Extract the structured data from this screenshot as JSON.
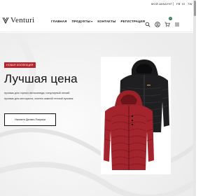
{
  "utility_bar": {
    "account_label": "МОЙ АККАУНТ",
    "social": [
      {
        "name": "facebook-icon",
        "label": "FB"
      },
      {
        "name": "instagram-icon",
        "label": "IG"
      },
      {
        "name": "twitter-icon",
        "label": "TW"
      }
    ]
  },
  "header": {
    "logo_text": "Venturi",
    "nav": [
      {
        "label": "ГЛАВНАЯ",
        "has_dropdown": false
      },
      {
        "label": "ПРОДУКТЫ",
        "has_dropdown": true
      },
      {
        "label": "КОНТАКТЫ",
        "has_dropdown": false
      },
      {
        "label": "РЕГИСТРАЦИЯ",
        "has_dropdown": false
      }
    ],
    "icons": [
      "search-icon",
      "user-icon",
      "cart-icon",
      "menu-icon"
    ],
    "cart_count": "0"
  },
  "hero": {
    "tag": "НОВАЯ КОЛЛЕКЦИЯ",
    "title": "Лучшая цена",
    "subtitle_lines": [
      "пуховик для горного велосипеда; популярный легкий",
      "пуховик для мотоцикла, осенне-зимний теплый пуховик"
    ],
    "cta_label": "Начните Делать Покупки",
    "products": [
      {
        "name": "black-puffer-jacket",
        "color": "#1d1d1f"
      },
      {
        "name": "red-puffer-jacket",
        "color": "#a3242c"
      }
    ]
  },
  "colors": {
    "accent": "#b7242b",
    "cart_badge": "#2b7a4b",
    "text": "#111111"
  }
}
